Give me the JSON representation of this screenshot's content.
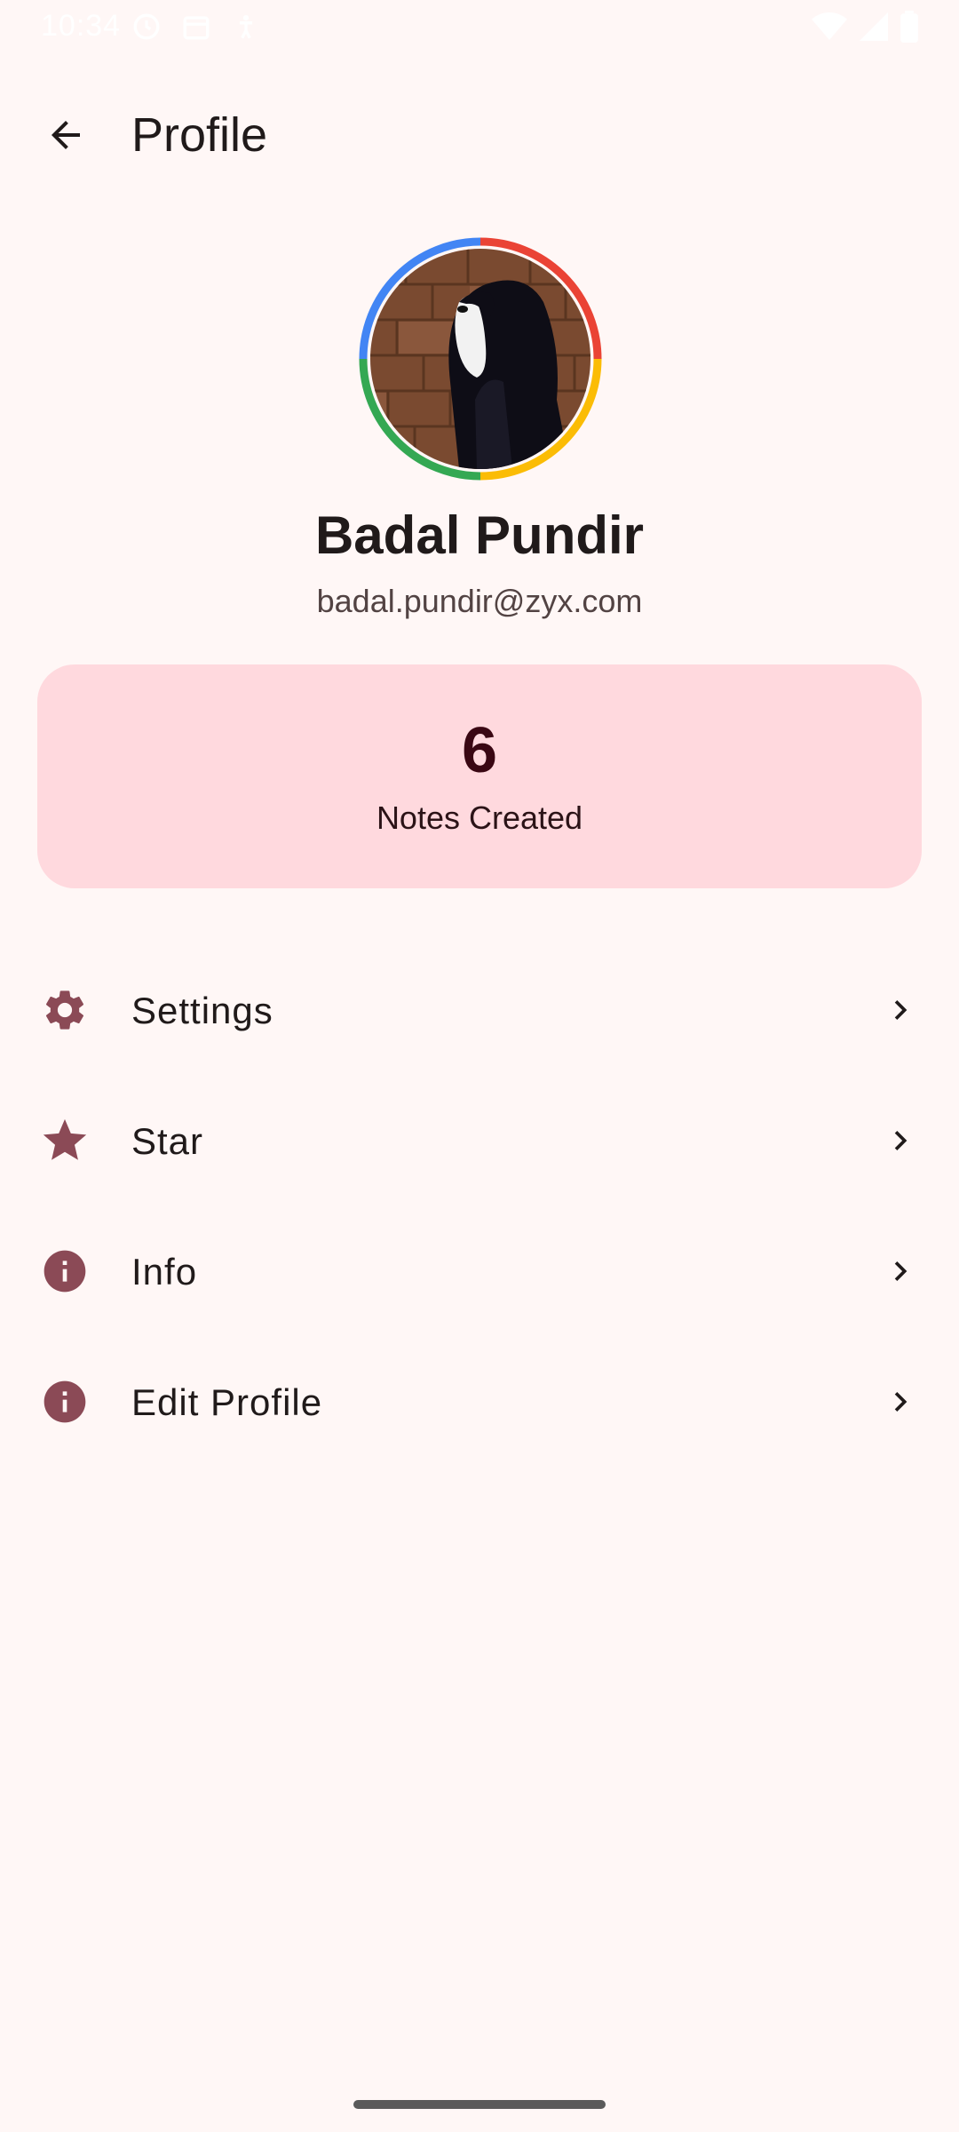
{
  "status_bar": {
    "time": "10:34",
    "left_icons": [
      "shield-icon",
      "calendar-icon",
      "accessibility-icon"
    ],
    "right_icons": [
      "wifi-icon",
      "signal-icon",
      "battery-icon"
    ]
  },
  "app_bar": {
    "back_icon": "arrow-back-icon",
    "title": "Profile"
  },
  "profile": {
    "name": "Badal Pundir",
    "email": "badal.pundir@zyx.com",
    "ring_colors": [
      "#EA4335",
      "#FBBC05",
      "#34A853",
      "#4285F4"
    ]
  },
  "stats": {
    "value": "6",
    "label": "Notes Created"
  },
  "menu": {
    "items": [
      {
        "label": "Settings",
        "icon": "gear-icon"
      },
      {
        "label": "Star",
        "icon": "star-icon"
      },
      {
        "label": "Info",
        "icon": "info-icon"
      },
      {
        "label": "Edit Profile",
        "icon": "info-icon"
      }
    ]
  },
  "colors": {
    "background": "#FFF7F6",
    "accent": "#8B4A56",
    "card": "#FFD9DE"
  }
}
